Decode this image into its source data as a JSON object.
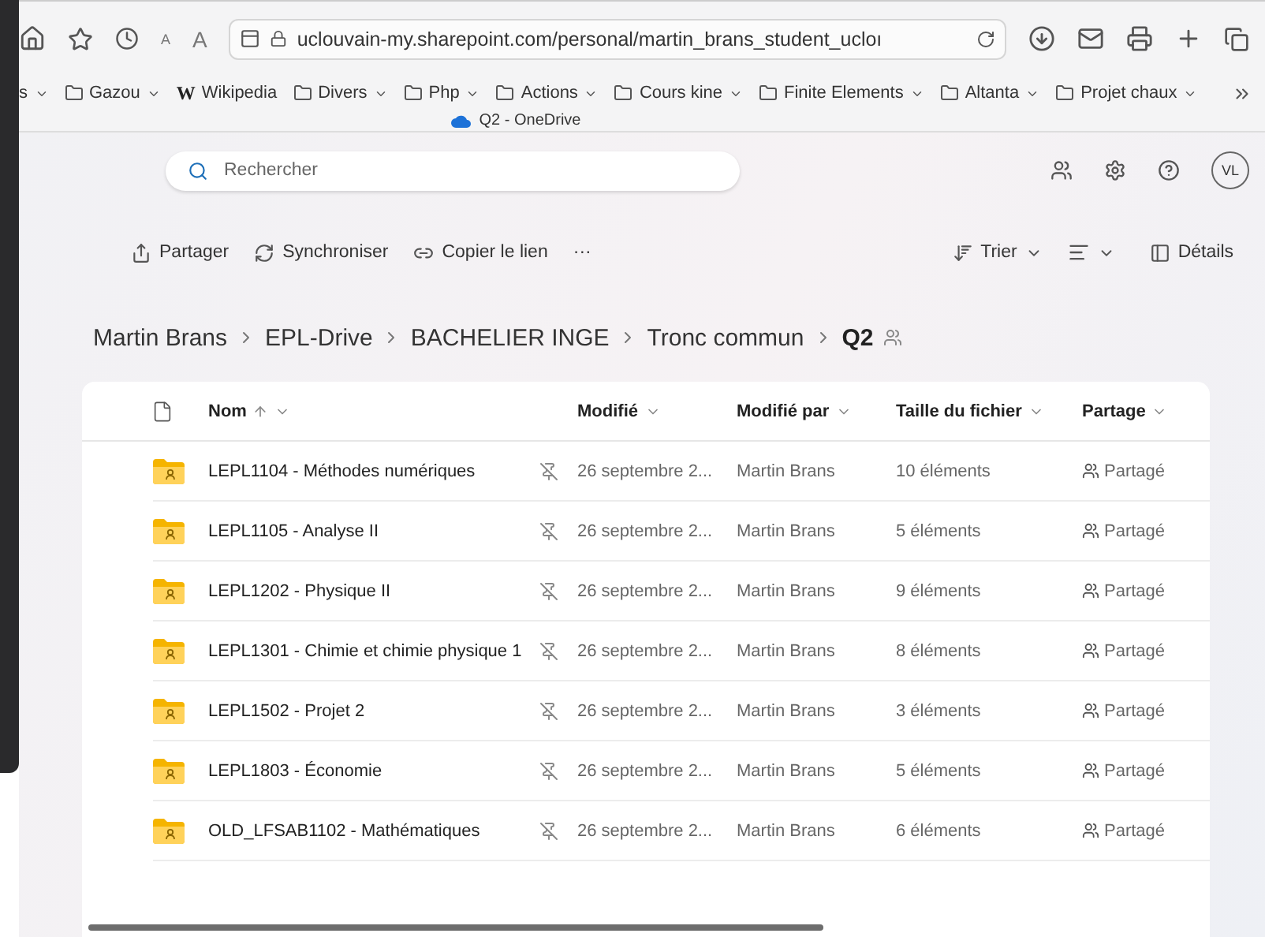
{
  "browser": {
    "url": "uclouvain-my.sharepoint.com/personal/martin_brans_student_ucloı",
    "tab_title": "Q2 - OneDrive",
    "bookmarks": [
      {
        "label": "s",
        "kind": "folder-cut"
      },
      {
        "label": "Gazou",
        "kind": "folder"
      },
      {
        "label": "Wikipedia",
        "kind": "wiki",
        "logo": "W"
      },
      {
        "label": "Divers",
        "kind": "folder"
      },
      {
        "label": "Php",
        "kind": "folder"
      },
      {
        "label": "Actions",
        "kind": "folder"
      },
      {
        "label": "Cours kine",
        "kind": "folder"
      },
      {
        "label": "Finite Elements",
        "kind": "folder"
      },
      {
        "label": "Altanta",
        "kind": "folder"
      },
      {
        "label": "Projet chaux",
        "kind": "folder"
      }
    ],
    "font_small": "A",
    "font_large": "A"
  },
  "header": {
    "search_placeholder": "Rechercher",
    "avatar": "VL"
  },
  "commands": {
    "left": [
      "Partager",
      "Synchroniser",
      "Copier le lien"
    ],
    "more": "···",
    "sort": "Trier",
    "details": "Détails"
  },
  "breadcrumb": [
    "Martin Brans",
    "EPL-Drive",
    "BACHELIER INGE",
    "Tronc commun",
    "Q2"
  ],
  "table": {
    "columns": [
      {
        "label": "Nom",
        "sorted": true
      },
      {
        "label": "Modifié",
        "sorted": false
      },
      {
        "label": "Modifié par",
        "sorted": false
      },
      {
        "label": "Taille du fichier",
        "sorted": false
      },
      {
        "label": "Partage",
        "sorted": false
      }
    ],
    "rows": [
      {
        "name": "LEPL1104 - Méthodes numériques",
        "modified": "26 septembre 2...",
        "modified_by": "Martin Brans",
        "size": "10 éléments",
        "sharing": "Partagé"
      },
      {
        "name": "LEPL1105 - Analyse II",
        "modified": "26 septembre 2...",
        "modified_by": "Martin Brans",
        "size": "5 éléments",
        "sharing": "Partagé"
      },
      {
        "name": "LEPL1202 - Physique II",
        "modified": "26 septembre 2...",
        "modified_by": "Martin Brans",
        "size": "9 éléments",
        "sharing": "Partagé"
      },
      {
        "name": "LEPL1301 - Chimie et chimie physique 1",
        "modified": "26 septembre 2...",
        "modified_by": "Martin Brans",
        "size": "8 éléments",
        "sharing": "Partagé"
      },
      {
        "name": "LEPL1502 - Projet 2",
        "modified": "26 septembre 2...",
        "modified_by": "Martin Brans",
        "size": "3 éléments",
        "sharing": "Partagé"
      },
      {
        "name": "LEPL1803 - Économie",
        "modified": "26 septembre 2...",
        "modified_by": "Martin Brans",
        "size": "5 éléments",
        "sharing": "Partagé"
      },
      {
        "name": "OLD_LFSAB1102 - Mathématiques",
        "modified": "26 septembre 2...",
        "modified_by": "Martin Brans",
        "size": "6 éléments",
        "sharing": "Partagé"
      }
    ]
  }
}
